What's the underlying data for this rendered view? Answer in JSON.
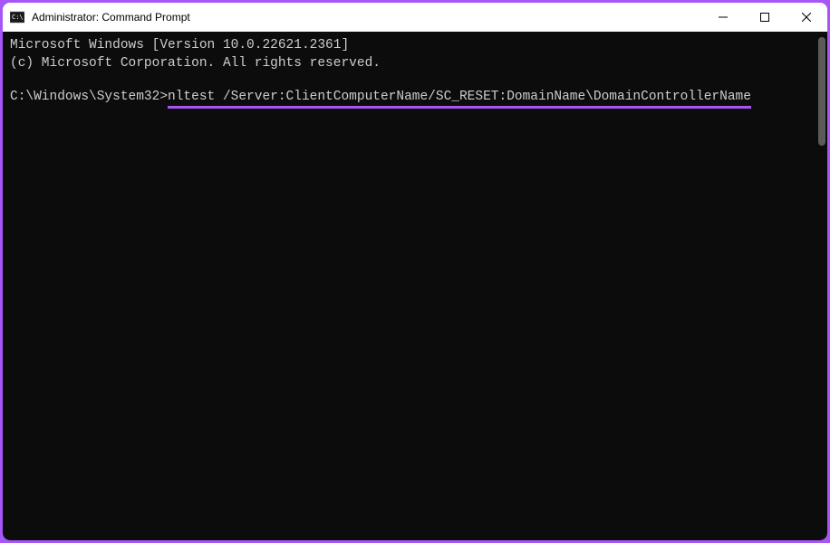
{
  "window": {
    "title": "Administrator: Command Prompt"
  },
  "terminal": {
    "line1": "Microsoft Windows [Version 10.0.22621.2361]",
    "line2": "(c) Microsoft Corporation. All rights reserved.",
    "prompt": "C:\\Windows\\System32>",
    "command": "nltest /Server:ClientComputerName/SC_RESET:DomainName\\DomainControllerName"
  },
  "colors": {
    "accent": "#a855f7",
    "terminalBg": "#0c0c0c",
    "terminalFg": "#cccccc"
  }
}
